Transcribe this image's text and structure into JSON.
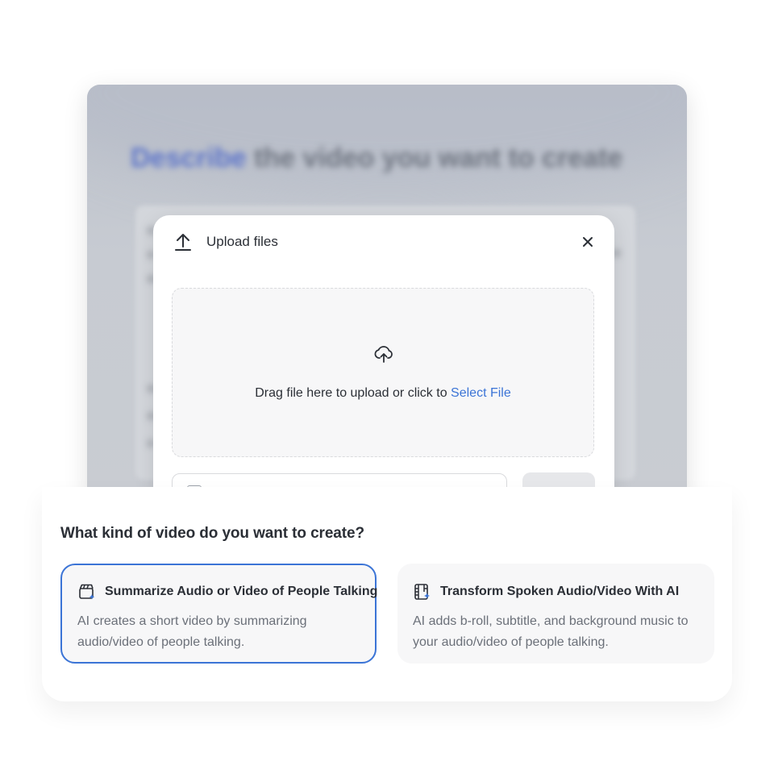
{
  "background_window": {
    "heading_accent": "Describe",
    "heading_rest": "the video you want to create"
  },
  "upload_modal": {
    "title": "Upload files",
    "icons": {
      "upload": "upload-arrow-icon",
      "close": "close-icon",
      "cloud": "cloud-upload-icon"
    },
    "dropzone": {
      "text": "Drag file here to upload or click to ",
      "link_label": "Select File"
    }
  },
  "video_type": {
    "question": "What kind of video do you want to create?",
    "options": [
      {
        "title": "Summarize Audio or Video of People Talking",
        "description": "AI creates a short video by summarizing audio/video of people talking.",
        "icon": "clapperboard-sparkle-icon",
        "selected": true
      },
      {
        "title": "Transform Spoken Audio/Video With AI",
        "description": "AI adds b-roll, subtitle, and background music to your audio/video of people talking.",
        "icon": "film-sparkle-icon",
        "selected": false
      }
    ]
  },
  "colors": {
    "accent": "#3b74d6",
    "text_primary": "#2b2f36",
    "text_secondary": "#6b7079",
    "surface": "#f7f7f8"
  }
}
